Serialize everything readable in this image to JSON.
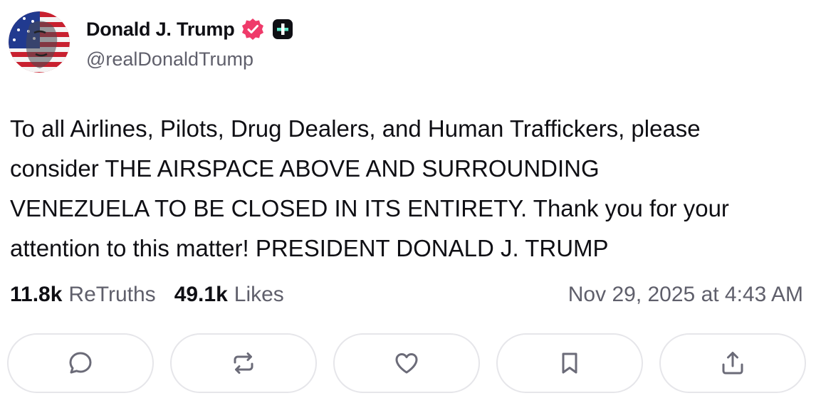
{
  "author": {
    "display_name": "Donald J. Trump",
    "handle": "@realDonaldTrump",
    "avatar_icon": "avatar-image",
    "verified_badge_icon": "verified-badge-icon",
    "verified_badge_color": "#ef3a6a",
    "plus_badge_icon": "plus-badge-icon"
  },
  "post": {
    "text": "To all Airlines, Pilots, Drug Dealers, and Human Traffickers, please\nconsider THE AIRSPACE ABOVE AND SURROUNDING\nVENEZUELA TO BE CLOSED IN ITS ENTIRETY. Thank you for your\nattention to this matter! PRESIDENT DONALD J. TRUMP"
  },
  "stats": {
    "retruths_count": "11.8k",
    "retruths_label": "ReTruths",
    "likes_count": "49.1k",
    "likes_label": "Likes",
    "timestamp": "Nov 29, 2025 at 4:43 AM"
  },
  "actions": [
    {
      "name": "reply",
      "icon": "comment-icon"
    },
    {
      "name": "retruth",
      "icon": "repost-icon"
    },
    {
      "name": "like",
      "icon": "heart-icon"
    },
    {
      "name": "bookmark",
      "icon": "bookmark-icon"
    },
    {
      "name": "share",
      "icon": "share-icon"
    }
  ],
  "colors": {
    "text_primary": "#0f0f14",
    "text_secondary": "#5f5f6b",
    "button_border": "#e6e6ea",
    "icon_gray": "#6b6b78"
  }
}
